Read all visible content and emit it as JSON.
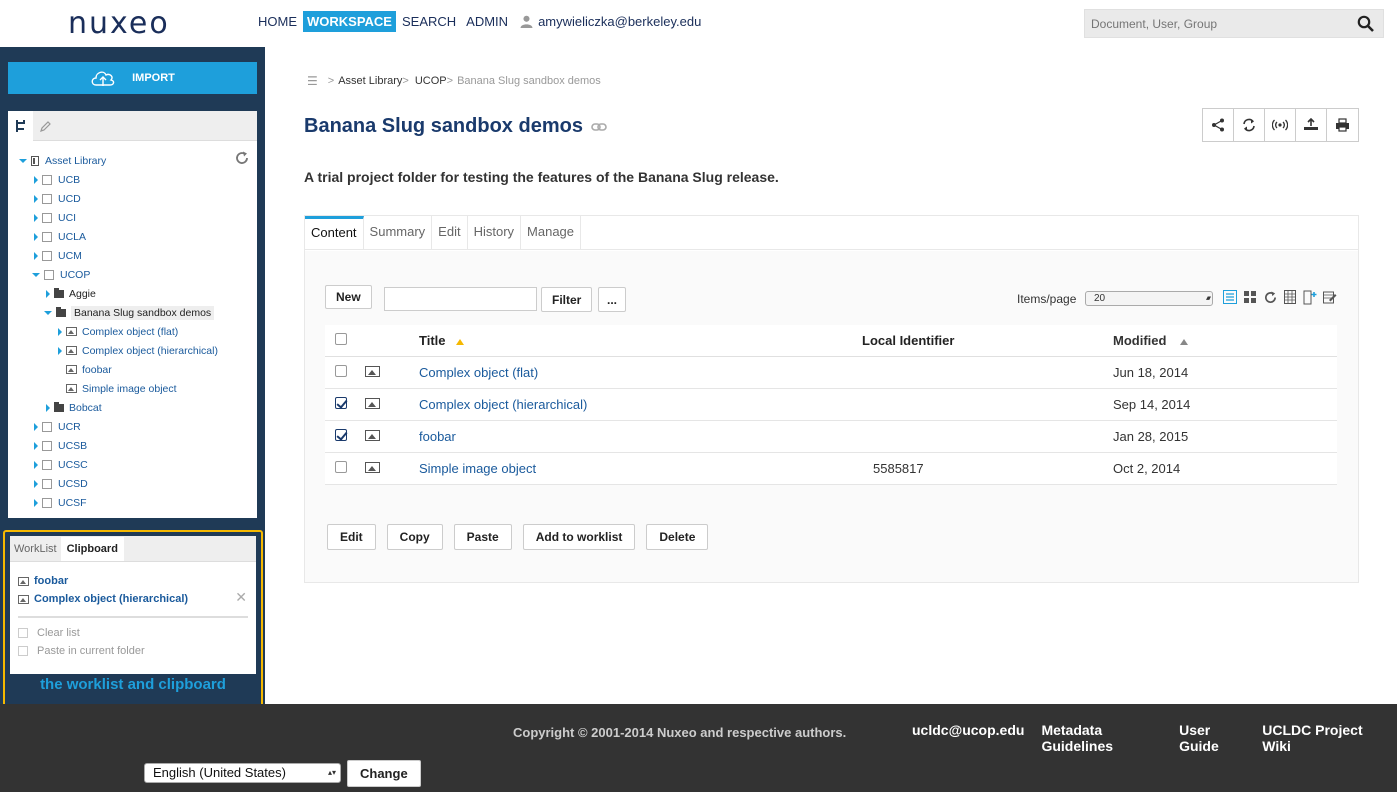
{
  "header": {
    "logo": "nuxeo",
    "nav": [
      "HOME",
      "WORKSPACE",
      "SEARCH",
      "ADMIN"
    ],
    "user": "amywieliczka@berkeley.edu",
    "search_placeholder": "Document, User, Group"
  },
  "sidebar": {
    "import_label": "IMPORT",
    "tree": {
      "root": "Asset Library",
      "ucb": "UCB",
      "ucd": "UCD",
      "uci": "UCI",
      "ucla": "UCLA",
      "ucm": "UCM",
      "ucop": "UCOP",
      "aggie": "Aggie",
      "banana": "Banana Slug sandbox demos",
      "flat": "Complex object (flat)",
      "hier": "Complex object (hierarchical)",
      "foobar": "foobar",
      "simple": "Simple image object",
      "bobcat": "Bobcat",
      "ucr": "UCR",
      "ucsb": "UCSB",
      "ucsc": "UCSC",
      "ucsd": "UCSD",
      "ucsf": "UCSF"
    },
    "clip": {
      "tab_worklist": "WorkList",
      "tab_clipboard": "Clipboard",
      "items": [
        "foobar",
        "Complex object (hierarchical)"
      ],
      "clear": "Clear list",
      "paste": "Paste in current folder",
      "caption": "the worklist and clipboard"
    }
  },
  "main": {
    "breadcrumb": {
      "b1": "Asset Library",
      "b2": "UCOP",
      "b3": "Banana Slug sandbox demos"
    },
    "title": "Banana Slug sandbox demos",
    "description": "A trial project folder for testing the features of the Banana Slug release.",
    "tabs": [
      "Content",
      "Summary",
      "Edit",
      "History",
      "Manage"
    ],
    "new_label": "New",
    "filter_label": "Filter",
    "more_label": "...",
    "items_label": "Items/page",
    "items_value": "20",
    "columns": {
      "title": "Title",
      "local": "Local Identifier",
      "modified": "Modified"
    },
    "rows": [
      {
        "title": "Complex object (flat)",
        "local": "",
        "modified": "Jun 18, 2014",
        "checked": false
      },
      {
        "title": "Complex object (hierarchical)",
        "local": "",
        "modified": "Sep 14, 2014",
        "checked": true
      },
      {
        "title": "foobar",
        "local": "",
        "modified": "Jan 28, 2015",
        "checked": true
      },
      {
        "title": "Simple image object",
        "local": "5585817",
        "modified": "Oct 2, 2014",
        "checked": false
      }
    ],
    "actions": [
      "Edit",
      "Copy",
      "Paste",
      "Add to worklist",
      "Delete"
    ]
  },
  "footer": {
    "copyright": "Copyright © 2001-2014 Nuxeo and respective authors.",
    "links": [
      "ucldc@ucop.edu",
      "Metadata Guidelines",
      "User Guide",
      "UCLDC Project Wiki"
    ],
    "language": "English (United States)",
    "change_label": "Change"
  },
  "colors": {
    "accent": "#1e9fdb",
    "sidebar": "#1f3a56",
    "highlight": "#f5b800",
    "footer": "#333333"
  }
}
